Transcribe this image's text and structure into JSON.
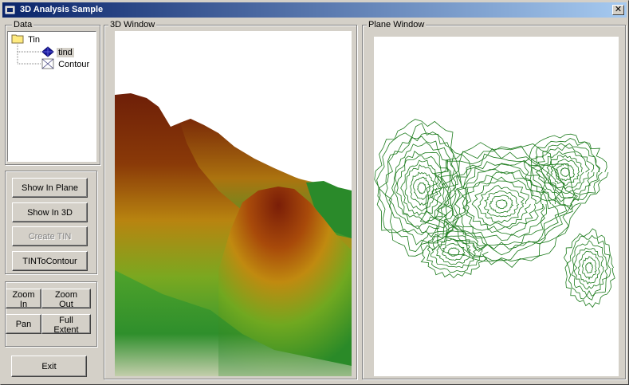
{
  "window": {
    "title": "3D Analysis Sample",
    "close_glyph": "✕"
  },
  "data_group": {
    "legend": "Data",
    "tree": [
      {
        "label": "Tin",
        "icon": "folder-icon"
      },
      {
        "label": "tind",
        "icon": "tin-layer-icon",
        "selected": true
      },
      {
        "label": "Contour",
        "icon": "contour-layer-icon"
      }
    ]
  },
  "buttons": {
    "show_in_plane": "Show In Plane",
    "show_in_3d": "Show In 3D",
    "create_tin": "Create TIN",
    "tin_to_contour": "TINToContour",
    "zoom_in": "Zoom In",
    "zoom_out": "Zoom Out",
    "pan": "Pan",
    "full_extent": "Full Extent",
    "exit": "Exit"
  },
  "view_3d": {
    "legend": "3D Window"
  },
  "plane_view": {
    "legend": "Plane Window",
    "contour_color": "#1a7a1a"
  },
  "colors": {
    "title_start": "#0a246a",
    "title_end": "#a6caf0",
    "face": "#d4d0c8"
  }
}
